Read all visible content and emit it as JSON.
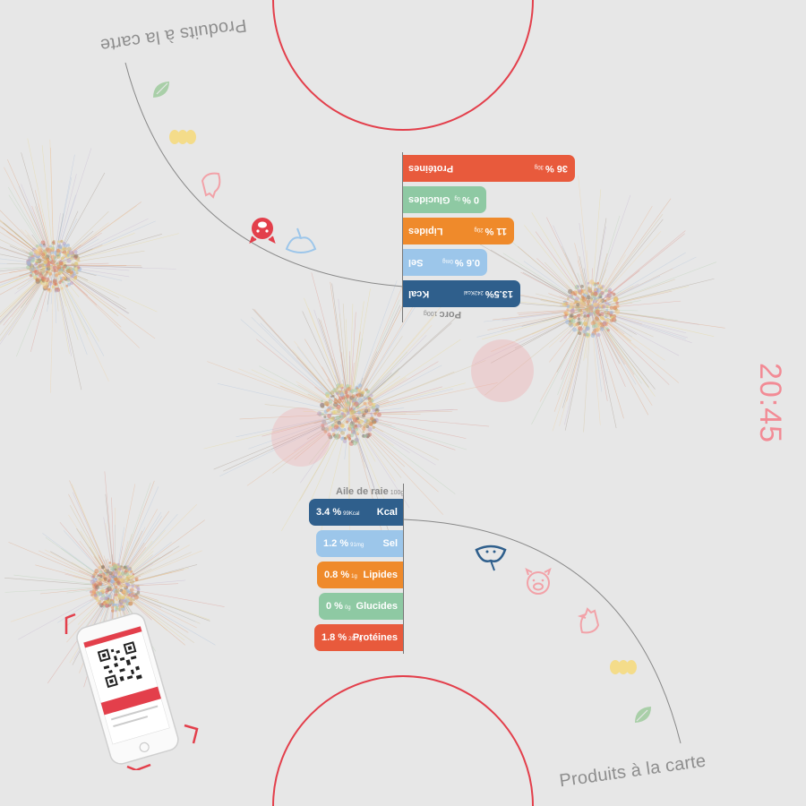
{
  "curve_label": "Produits à la carte",
  "clock": "20:45",
  "colors": {
    "kcal": "#2f5f8c",
    "sel": "#9cc6ea",
    "lipides": "#ef8a2b",
    "glucides": "#8ec9a3",
    "proteines": "#e85a3c",
    "accent": "#e33f4b"
  },
  "top_card": {
    "title": "Porc",
    "title_unit": "100g",
    "rows": [
      {
        "label": "Kcal",
        "value": "13.5%",
        "unit": "242Kcal",
        "fill": 0.145
      },
      {
        "label": "Sel",
        "value": "0.6 %",
        "unit": "0mg",
        "fill": 0.104
      },
      {
        "label": "Lipides",
        "value": "11 %",
        "unit": "20g",
        "fill": 0.138
      },
      {
        "label": "Glucides",
        "value": "0 %",
        "unit": "0g",
        "fill": 0.103
      },
      {
        "label": "Protéines",
        "value": "36 %",
        "unit": "30g",
        "fill": 0.213
      }
    ]
  },
  "bottom_card": {
    "title": "Aile de raie",
    "title_unit": "100g",
    "rows": [
      {
        "label": "Kcal",
        "value": "3.4 %",
        "unit": "99Kcal",
        "fill": 0.117
      },
      {
        "label": "Sel",
        "value": "1.2 %",
        "unit": "91mg",
        "fill": 0.108
      },
      {
        "label": "Lipides",
        "value": "0.8 %",
        "unit": "1g",
        "fill": 0.107
      },
      {
        "label": "Glucides",
        "value": "0 %",
        "unit": "0g",
        "fill": 0.104
      },
      {
        "label": "Protéines",
        "value": "1.8 %",
        "unit": "20.7g",
        "fill": 0.11
      }
    ]
  },
  "icons": [
    "leaf-icon",
    "eggs-icon",
    "chicken-icon",
    "pig-icon",
    "ray-fish-icon"
  ]
}
